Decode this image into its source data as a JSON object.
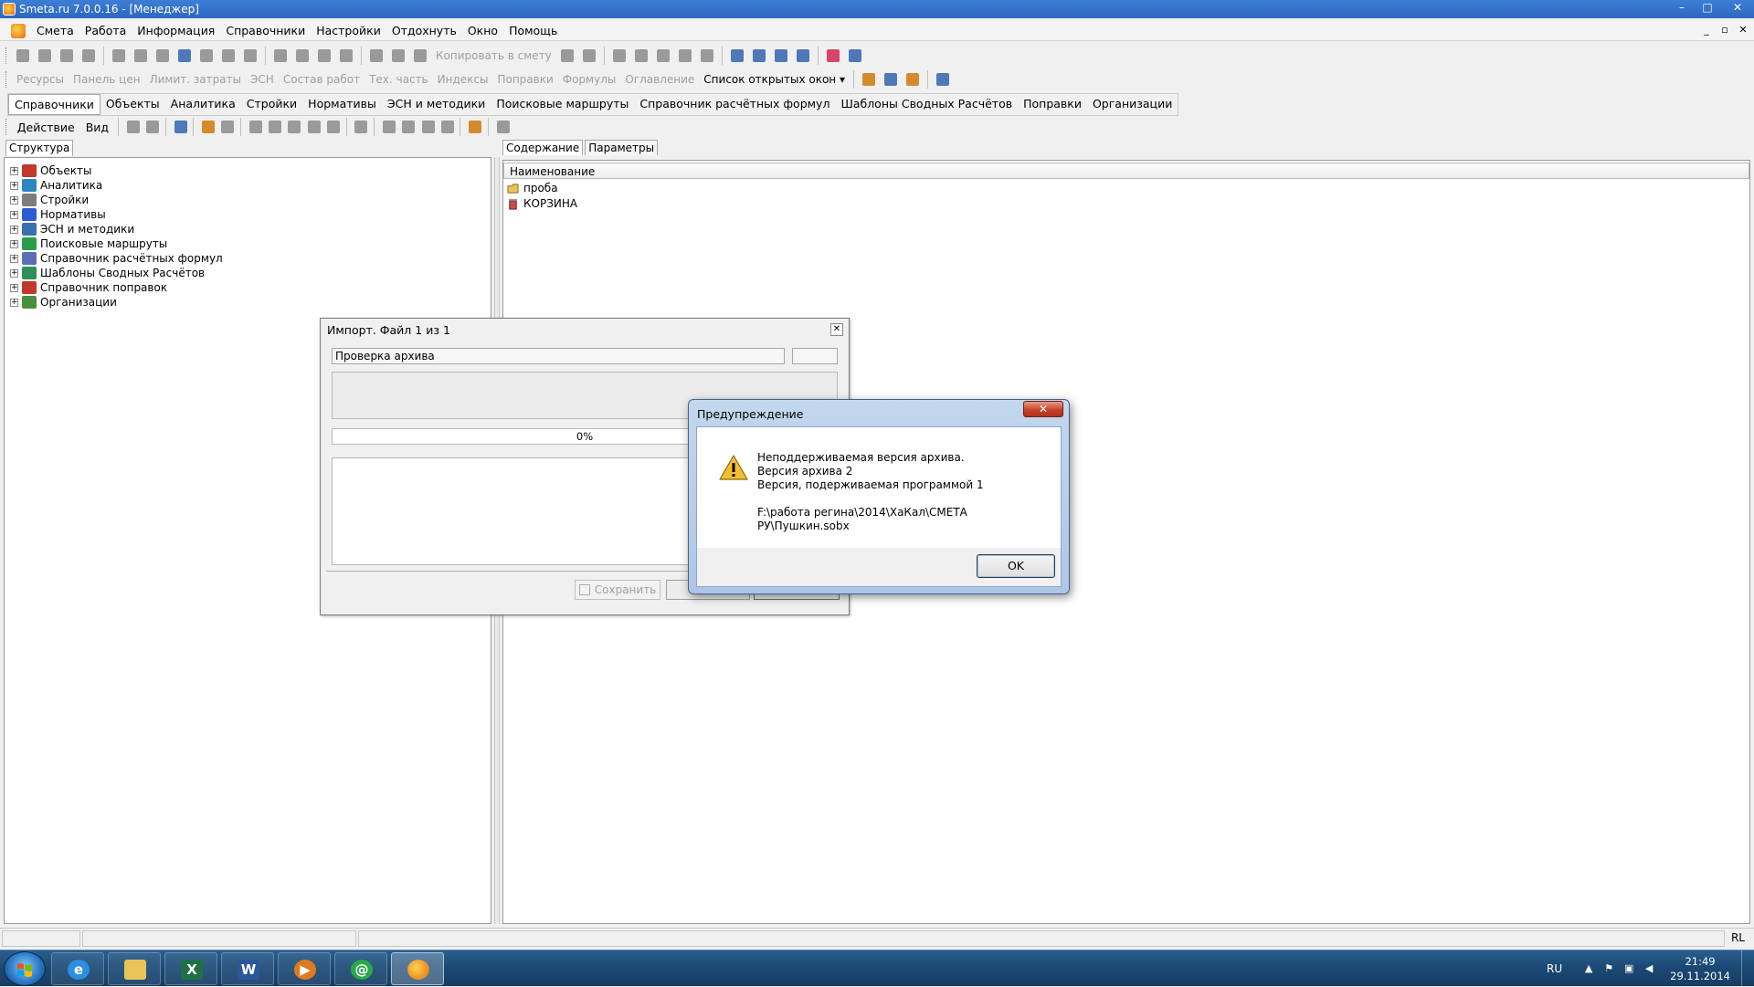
{
  "window": {
    "title": "Smeta.ru  7.0.0.16  - [Менеджер]",
    "controls": [
      "–",
      "□",
      "✕"
    ]
  },
  "menu": {
    "items": [
      "Смета",
      "Работа",
      "Информация",
      "Справочники",
      "Настройки",
      "Отдохнуть",
      "Окно",
      "Помощь"
    ],
    "mdi_controls": [
      "_",
      "▫",
      "✕"
    ]
  },
  "toolbar1": {
    "copy_to_estimate": "Копировать в смету"
  },
  "toolbar2": {
    "items": [
      "Ресурсы",
      "Панель цен",
      "Лимит. затраты",
      "ЭСН",
      "Состав работ",
      "Тех. часть",
      "Индексы",
      "Поправки",
      "Формулы",
      "Оглавление"
    ],
    "open_windows": "Список открытых окон"
  },
  "tabs": {
    "active": "Справочники",
    "items": [
      "Объекты",
      "Аналитика",
      "Стройки",
      "Нормативы",
      "ЭСН и методики",
      "Поисковые маршруты",
      "Справочник расчётных формул",
      "Шаблоны Сводных Расчётов",
      "Поправки",
      "Организации"
    ]
  },
  "actionbar": {
    "action": "Действие",
    "view": "Вид"
  },
  "left_panel": {
    "tab": "Структура",
    "tree": [
      {
        "label": "Объекты",
        "icon": "objects-icon",
        "color": "#c0392b"
      },
      {
        "label": "Аналитика",
        "icon": "analytics-icon",
        "color": "#2e86c1"
      },
      {
        "label": "Стройки",
        "icon": "construction-icon",
        "color": "#7d7d7d"
      },
      {
        "label": "Нормативы",
        "icon": "norms-icon",
        "color": "#2e5bd1"
      },
      {
        "label": "ЭСН и методики",
        "icon": "esn-icon",
        "color": "#3a6fb0"
      },
      {
        "label": "Поисковые маршруты",
        "icon": "search-routes-icon",
        "color": "#2a9d4a"
      },
      {
        "label": "Справочник расчётных формул",
        "icon": "formulas-icon",
        "color": "#5a6fb8"
      },
      {
        "label": "Шаблоны Сводных Расчётов",
        "icon": "templates-icon",
        "color": "#2f8f5a"
      },
      {
        "label": "Справочник поправок",
        "icon": "corrections-icon",
        "color": "#c0392b"
      },
      {
        "label": "Организации",
        "icon": "organizations-icon",
        "color": "#4a8f3a"
      }
    ]
  },
  "right_panel": {
    "tabs": [
      "Содержание",
      "Параметры"
    ],
    "column": "Наименование",
    "rows": [
      {
        "label": "проба",
        "icon": "folder-icon"
      },
      {
        "label": "КОРЗИНА",
        "icon": "trash-icon"
      }
    ]
  },
  "import_dialog": {
    "title": "Импорт. Файл 1 из 1",
    "status": "Проверка архива",
    "progress_percent": 0,
    "progress_text": "0%",
    "save": "Сохранить"
  },
  "warning_dialog": {
    "title": "Предупреждение",
    "lines": [
      "Неподдерживаемая версия архива.",
      "Версия архива 2",
      "Версия, подерживаемая программой 1"
    ],
    "path": "F:\\работа регина\\2014\\ХаКал\\СМЕТА РУ\\Пушкин.sobx",
    "ok": "OK",
    "close": "✕"
  },
  "statusbar": {
    "lang": "RL"
  },
  "taskbar": {
    "apps": [
      "ie-icon",
      "explorer-icon",
      "excel-icon",
      "word-icon",
      "media-player-icon",
      "mail-agent-icon",
      "smeta-icon"
    ],
    "lang": "RU",
    "time": "21:49",
    "date": "29.11.2014"
  }
}
